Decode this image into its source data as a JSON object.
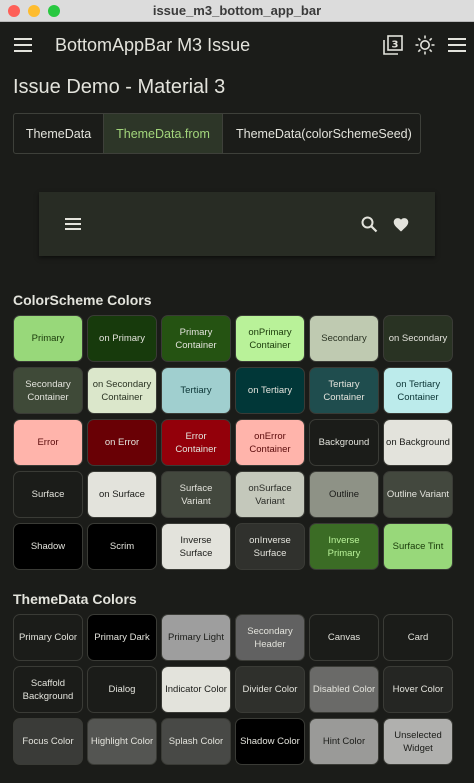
{
  "window": {
    "title": "issue_m3_bottom_app_bar"
  },
  "appbar": {
    "title": "BottomAppBar M3 Issue",
    "badge": "3"
  },
  "page": {
    "heading": "Issue Demo - Material 3"
  },
  "segments": [
    {
      "label": "ThemeData",
      "selected": false
    },
    {
      "label": "ThemeData.from",
      "selected": true
    },
    {
      "label": "ThemeData(colorSchemeSeed)",
      "selected": false
    }
  ],
  "colorscheme": {
    "title": "ColorScheme Colors",
    "cells": [
      {
        "label": "Primary",
        "bg": "#98d87a",
        "fg": "#1a3a0a"
      },
      {
        "label": "on Primary",
        "bg": "#173a0c",
        "fg": "#e3e3dc"
      },
      {
        "label": "Primary Container",
        "bg": "#255312",
        "fg": "#e3e3dc"
      },
      {
        "label": "onPrimary Container",
        "bg": "#b9f299",
        "fg": "#1a3a0a"
      },
      {
        "label": "Secondary",
        "bg": "#bfcab1",
        "fg": "#2a3323"
      },
      {
        "label": "on Secondary",
        "bg": "#293323",
        "fg": "#e3e3dc"
      },
      {
        "label": "Secondary Container",
        "bg": "#3f4a38",
        "fg": "#e3e3dc"
      },
      {
        "label": "on Secondary Container",
        "bg": "#dbe7cb",
        "fg": "#2a3323"
      },
      {
        "label": "Tertiary",
        "bg": "#a0cfcf",
        "fg": "#0b3435"
      },
      {
        "label": "on Tertiary",
        "bg": "#013738",
        "fg": "#e3e3dc"
      },
      {
        "label": "Tertiary Container",
        "bg": "#1f4d4e",
        "fg": "#e3e3dc"
      },
      {
        "label": "on Tertiary Container",
        "bg": "#bcebeb",
        "fg": "#0b3435"
      },
      {
        "label": "Error",
        "bg": "#ffb4ab",
        "fg": "#5a0b0b"
      },
      {
        "label": "on Error",
        "bg": "#690005",
        "fg": "#e3e3dc"
      },
      {
        "label": "Error Container",
        "bg": "#93000a",
        "fg": "#e3e3dc"
      },
      {
        "label": "onError Container",
        "bg": "#ffb4ab",
        "fg": "#5a0b0b"
      },
      {
        "label": "Background",
        "bg": "#1b1c19",
        "fg": "#e3e3dc"
      },
      {
        "label": "on Background",
        "bg": "#e3e3dc",
        "fg": "#1b1c19"
      },
      {
        "label": "Surface",
        "bg": "#1b1c19",
        "fg": "#e3e3dc"
      },
      {
        "label": "on Surface",
        "bg": "#e3e3dc",
        "fg": "#1b1c19"
      },
      {
        "label": "Surface Variant",
        "bg": "#43483e",
        "fg": "#e3e3dc"
      },
      {
        "label": "onSurface Variant",
        "bg": "#c4c8bb",
        "fg": "#2b2d28"
      },
      {
        "label": "Outline",
        "bg": "#8e9286",
        "fg": "#1b1c19"
      },
      {
        "label": "Outline Variant",
        "bg": "#43483e",
        "fg": "#e3e3dc"
      },
      {
        "label": "Shadow",
        "bg": "#000000",
        "fg": "#e3e3dc"
      },
      {
        "label": "Scrim",
        "bg": "#000000",
        "fg": "#e3e3dc"
      },
      {
        "label": "Inverse Surface",
        "bg": "#e3e3dc",
        "fg": "#1b1c19"
      },
      {
        "label": "onInverse Surface",
        "bg": "#30312d",
        "fg": "#e3e3dc"
      },
      {
        "label": "Inverse Primary",
        "bg": "#3b6c25",
        "fg": "#b9f299"
      },
      {
        "label": "Surface Tint",
        "bg": "#98d87a",
        "fg": "#1a3a0a"
      }
    ]
  },
  "themedata": {
    "title": "ThemeData Colors",
    "cells": [
      {
        "label": "Primary Color",
        "bg": "#1b1c19",
        "fg": "#e3e3dc"
      },
      {
        "label": "Primary Dark",
        "bg": "#000000",
        "fg": "#e3e3dc"
      },
      {
        "label": "Primary Light",
        "bg": "#9e9e9e",
        "fg": "#1b1c19"
      },
      {
        "label": "Secondary Header",
        "bg": "#616161",
        "fg": "#e3e3dc"
      },
      {
        "label": "Canvas",
        "bg": "#1b1c19",
        "fg": "#e3e3dc"
      },
      {
        "label": "Card",
        "bg": "#1b1c19",
        "fg": "#e3e3dc"
      },
      {
        "label": "Scaffold Background",
        "bg": "#1b1c19",
        "fg": "#e3e3dc"
      },
      {
        "label": "Dialog",
        "bg": "#1b1c19",
        "fg": "#e3e3dc"
      },
      {
        "label": "Indicator Color",
        "bg": "#e3e3dc",
        "fg": "#1b1c19"
      },
      {
        "label": "Divider Color",
        "bg": "#2f302c",
        "fg": "#e3e3dc"
      },
      {
        "label": "Disabled Color",
        "bg": "#6a6a68",
        "fg": "#e3e3dc"
      },
      {
        "label": "Hover Color",
        "bg": "#252623",
        "fg": "#e3e3dc"
      },
      {
        "label": "Focus Color",
        "bg": "#3a3b38",
        "fg": "#e3e3dc"
      },
      {
        "label": "Highlight Color",
        "bg": "#545552",
        "fg": "#e3e3dc"
      },
      {
        "label": "Splash Color",
        "bg": "#484946",
        "fg": "#e3e3dc"
      },
      {
        "label": "Shadow Color",
        "bg": "#000000",
        "fg": "#e3e3dc"
      },
      {
        "label": "Hint Color",
        "bg": "#9a9a98",
        "fg": "#1b1c19"
      },
      {
        "label": "Unselected Widget",
        "bg": "#b0b0ae",
        "fg": "#1b1c19"
      }
    ]
  }
}
